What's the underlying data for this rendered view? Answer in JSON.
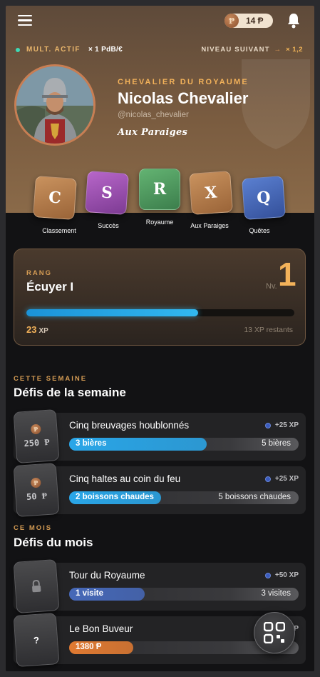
{
  "header": {
    "coin_symbol": "Ᵽ",
    "coin_count": "14 Ᵽ",
    "multiplier_label": "MULT. ACTIF",
    "multiplier_value": "× 1 PdB/€",
    "next_level_label": "NIVEAU SUIVANT",
    "next_level_arrow": "→",
    "next_level_value": "× 1,2",
    "icons": [
      "menu-icon",
      "bell-icon",
      "coin-icon"
    ]
  },
  "profile": {
    "rank_title": "CHEVALIER DU ROYAUME",
    "name": "Nicolas Chevalier",
    "handle": "@nicolas_chevalier",
    "establishment": "Aux Paraiges"
  },
  "nav": {
    "items": [
      {
        "letter": "C",
        "label": "Classement",
        "color": "#b7804f"
      },
      {
        "letter": "S",
        "label": "Succès",
        "color": "#9a4fae"
      },
      {
        "letter": "R",
        "label": "Royaume",
        "color": "#4f9a5e"
      },
      {
        "letter": "X",
        "label": "Aux Paraiges",
        "color": "#b7804f"
      },
      {
        "letter": "Q",
        "label": "Quêtes",
        "color": "#4668b8"
      }
    ]
  },
  "rank": {
    "label": "RANG",
    "name": "Écuyer I",
    "level_label": "Nv.",
    "level": "1",
    "xp_value": "23",
    "xp_unit": "XP",
    "remaining": "13 XP restants",
    "progress": 0.64,
    "accent": "#f3b25a"
  },
  "weekly": {
    "overline": "CETTE SEMAINE",
    "title": "Défis de la semaine",
    "challenges": [
      {
        "coin": "Ᵽ",
        "amount": "250 Ᵽ",
        "title": "Cinq breuvages houblonnés",
        "reward": "+25 XP",
        "current": "3 bières",
        "goal": "5 bières",
        "progress": 0.6,
        "color": "#2aa6e8"
      },
      {
        "coin": "Ᵽ",
        "amount": "50 Ᵽ",
        "title": "Cinq haltes au coin du feu",
        "reward": "+25 XP",
        "current": "2 boissons chaudes",
        "goal": "5 boissons chaudes",
        "progress": 0.4,
        "color": "#2aa6e8"
      }
    ]
  },
  "monthly": {
    "overline": "CE MOIS",
    "title": "Défis du mois",
    "challenges": [
      {
        "badge": "lock-icon",
        "title": "Tour du Royaume",
        "reward": "+50 XP",
        "current": "1 visite",
        "goal": "3 visites",
        "progress": 0.33,
        "color": "#4668b8"
      },
      {
        "badge_text": "?",
        "title": "Le Bon Buveur",
        "reward": "XP",
        "current": "1380 Ᵽ",
        "goal": "",
        "progress": 0.28,
        "color": "#e07a32"
      }
    ]
  },
  "fab": {
    "icon": "qr-code-icon"
  }
}
